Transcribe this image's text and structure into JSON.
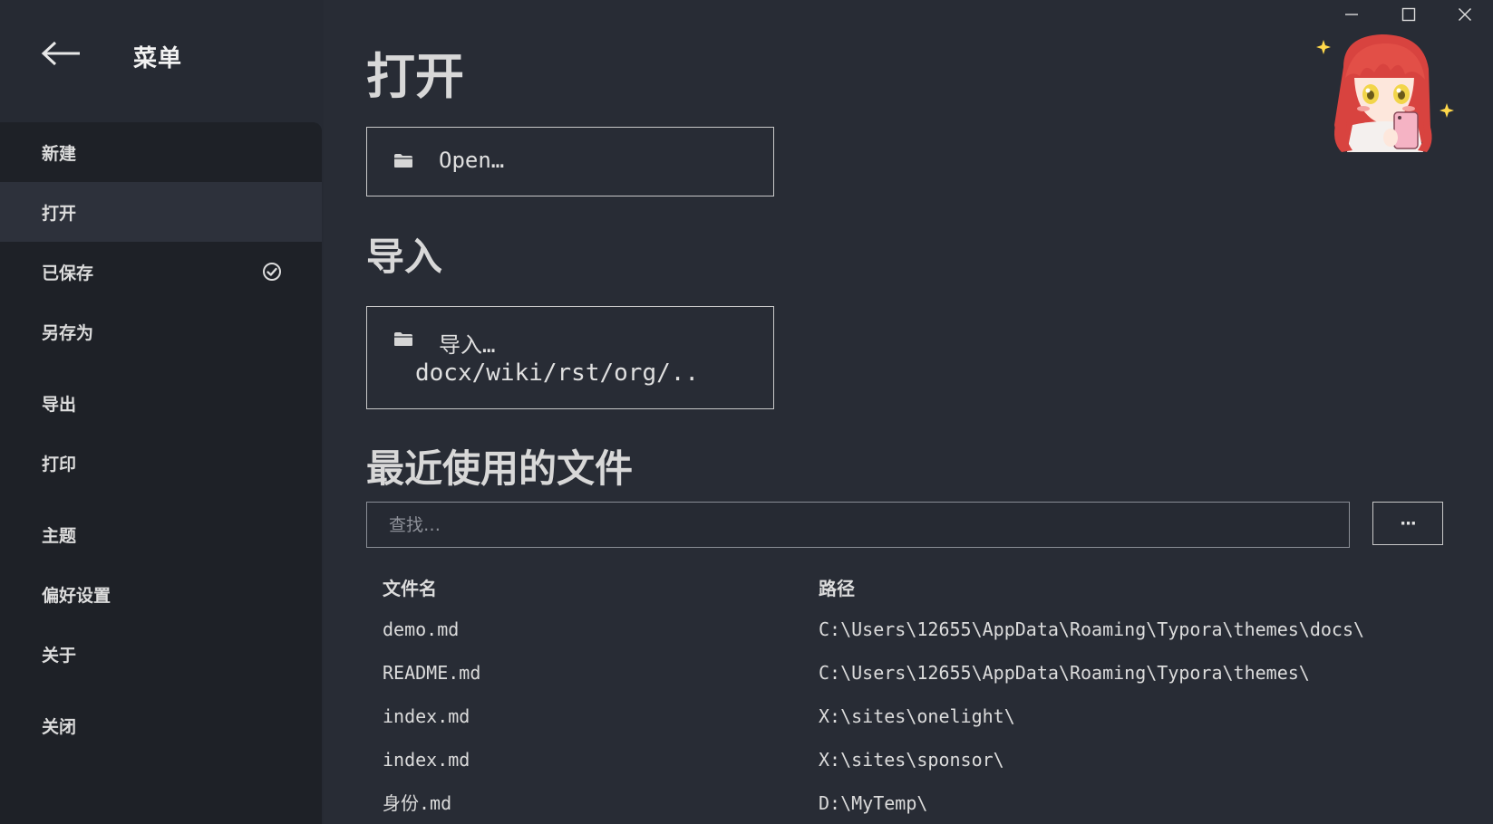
{
  "sidebar": {
    "title": "菜单",
    "items": [
      {
        "label": "新建"
      },
      {
        "label": "打开"
      },
      {
        "label": "已保存"
      },
      {
        "label": "另存为"
      },
      {
        "label": "导出"
      },
      {
        "label": "打印"
      },
      {
        "label": "主题"
      },
      {
        "label": "偏好设置"
      },
      {
        "label": "关于"
      },
      {
        "label": "关闭"
      }
    ]
  },
  "main": {
    "open_heading": "打开",
    "open_button": "Open…",
    "import_heading": "导入",
    "import_button_line1": "导入…",
    "import_button_line2": "docx/wiki/rst/org/..",
    "recent_heading": "最近使用的文件",
    "search_placeholder": "查找…",
    "more_button": "···",
    "table": {
      "headers": {
        "name": "文件名",
        "path": "路径"
      },
      "rows": [
        {
          "name": "demo.md",
          "path": "C:\\Users\\12655\\AppData\\Roaming\\Typora\\themes\\docs\\"
        },
        {
          "name": "README.md",
          "path": "C:\\Users\\12655\\AppData\\Roaming\\Typora\\themes\\"
        },
        {
          "name": "index.md",
          "path": "X:\\sites\\onelight\\"
        },
        {
          "name": "index.md",
          "path": "X:\\sites\\sponsor\\"
        },
        {
          "name": "身份.md",
          "path": "D:\\MyTemp\\"
        }
      ]
    }
  },
  "icons": {
    "back": "arrow-left-icon",
    "saved": "check-circle-icon",
    "folder": "folder-icon",
    "minimize": "minimize-icon",
    "maximize": "maximize-icon",
    "close": "close-icon"
  },
  "colors": {
    "background": "#282c35",
    "sidebar": "#262a33",
    "menu_panel": "#1e2127",
    "active_item": "#2d313b",
    "text": "#e6e6e6",
    "border": "#c9c9c9"
  }
}
